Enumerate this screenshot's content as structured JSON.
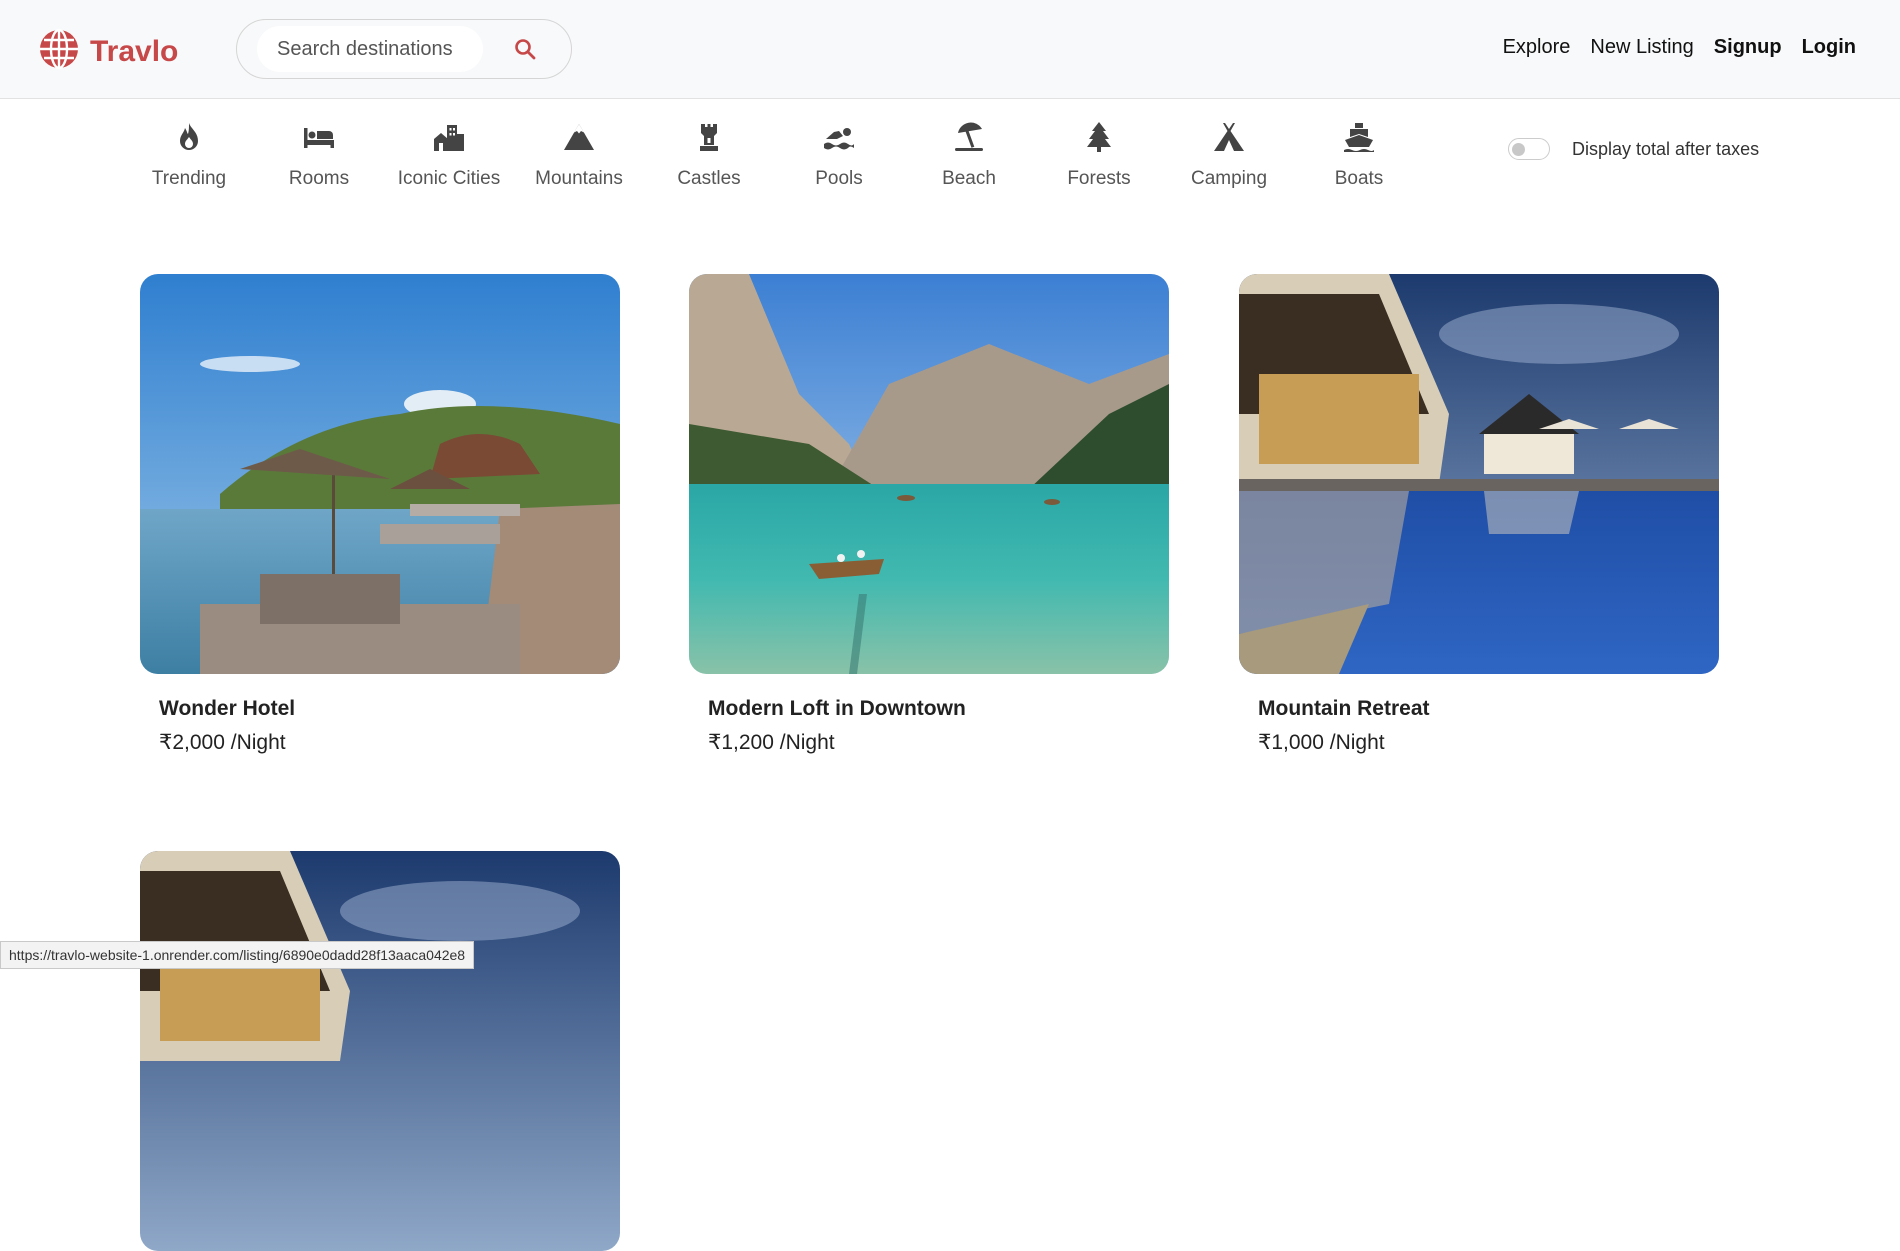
{
  "brand": {
    "name": "Travlo",
    "color": "#c74848"
  },
  "search": {
    "placeholder": "Search destinations",
    "value": ""
  },
  "nav": {
    "links": [
      {
        "label": "Explore",
        "bold": false
      },
      {
        "label": "New Listing",
        "bold": false
      },
      {
        "label": "Signup",
        "bold": true
      },
      {
        "label": "Login",
        "bold": true
      }
    ]
  },
  "filters": [
    {
      "label": "Trending",
      "icon": "fire-icon"
    },
    {
      "label": "Rooms",
      "icon": "bed-icon"
    },
    {
      "label": "Iconic Cities",
      "icon": "city-icon"
    },
    {
      "label": "Mountains",
      "icon": "mountain-icon"
    },
    {
      "label": "Castles",
      "icon": "castle-icon"
    },
    {
      "label": "Pools",
      "icon": "swimmer-icon"
    },
    {
      "label": "Beach",
      "icon": "umbrella-beach-icon"
    },
    {
      "label": "Forests",
      "icon": "tree-icon"
    },
    {
      "label": "Camping",
      "icon": "tent-icon"
    },
    {
      "label": "Boats",
      "icon": "ship-icon"
    }
  ],
  "tax_toggle": {
    "label": "Display total after taxes",
    "checked": false
  },
  "listings": [
    {
      "title": "Wonder Hotel",
      "price": "₹2,000 /Night",
      "image": "infinity pool by the sea"
    },
    {
      "title": "Modern Loft in Downtown",
      "price": "₹1,200 /Night",
      "image": "mountain lake with rowboat"
    },
    {
      "title": "Mountain Retreat",
      "price": "₹1,000 /Night",
      "image": "resort pool at dusk"
    },
    {
      "title": "",
      "price": "",
      "image": "resort pool at dusk"
    }
  ],
  "status_url": "https://travlo-website-1.onrender.com/listing/6890e0dadd28f13aaca042e8"
}
